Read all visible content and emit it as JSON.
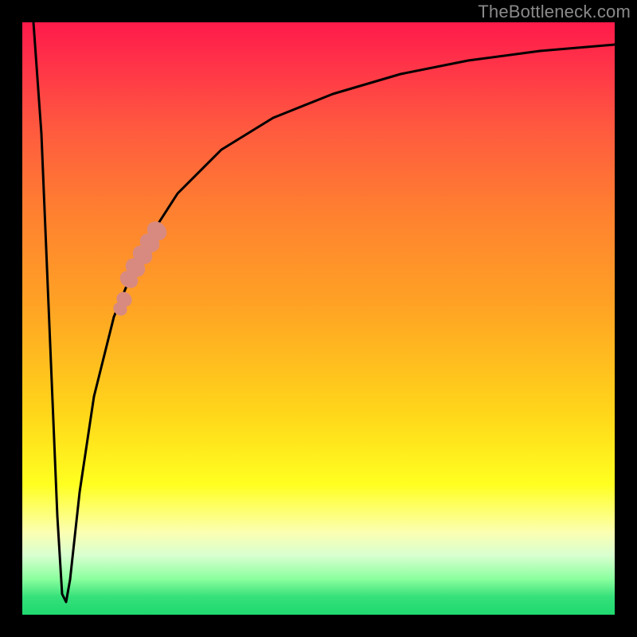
{
  "attribution": "TheBottleneck.com",
  "colors": {
    "gradient_top": "#ff1a4a",
    "gradient_mid1": "#ff8030",
    "gradient_mid2": "#ffff20",
    "gradient_bottom": "#1fd96f",
    "curve": "#000000",
    "marker": "#d88a80",
    "frame": "#000000"
  },
  "chart_data": {
    "type": "line",
    "title": "",
    "xlabel": "",
    "ylabel": "",
    "xlim": [
      0,
      100
    ],
    "ylim": [
      0,
      100
    ],
    "series": [
      {
        "name": "bottleneck-curve",
        "x": [
          0,
          2,
          4,
          6,
          6.8,
          7.5,
          9,
          11,
          14,
          18,
          23,
          29,
          36,
          44,
          53,
          63,
          74,
          86,
          100
        ],
        "y": [
          100,
          70,
          35,
          10,
          2,
          5,
          20,
          37,
          51,
          62,
          71,
          78,
          83,
          87,
          90,
          92.5,
          94.2,
          95.4,
          96.2
        ]
      }
    ],
    "markers": [
      {
        "name": "highlight-upper",
        "x_range": [
          18,
          23
        ],
        "y_range": [
          58,
          71
        ]
      },
      {
        "name": "highlight-lower",
        "x_range": [
          16.5,
          18
        ],
        "y_range": [
          52,
          57
        ]
      }
    ],
    "notch_min_x": 6.8
  }
}
